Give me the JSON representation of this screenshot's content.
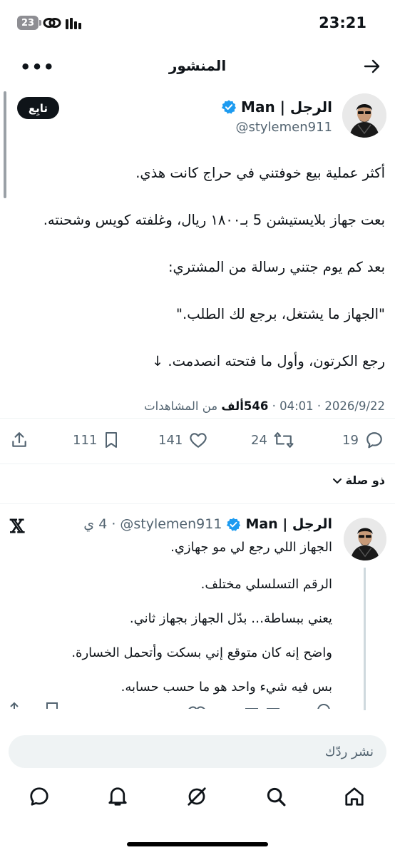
{
  "status_bar": {
    "time": "23:21",
    "battery": "23"
  },
  "header": {
    "title": "المنشور",
    "more": "•••"
  },
  "post": {
    "author_name": "الرجل | Man",
    "handle": "@stylemen911",
    "follow_label": "تابِع",
    "body": [
      "أكثر عملية بيع خوفتني في حراج كانت هذي.",
      "بعت جهاز بلايستيشن 5 بـ١٨٠٠ ريال، وغلفته كويس وشحنته.",
      "بعد كم يوم جتني رسالة من المشتري:",
      "\"الجهاز ما يشتغل، برجع لك الطلب.\"",
      "رجع الكرتون، وأول ما فتحته انصدمت. ↓"
    ],
    "date": "2026/9/22",
    "time": "04:01",
    "views_count": "546ألف",
    "views_label": "من المشاهدات",
    "separator": "·",
    "replies": "19",
    "reposts": "24",
    "likes": "141",
    "bookmarks": "111"
  },
  "related_label": "ذو صلة",
  "related_post": {
    "author_name": "الرجل | Man",
    "handle": "@stylemen911",
    "age": "4 ي",
    "separator": "·",
    "platform_logo": "𝕏",
    "body": [
      "الجهاز اللي رجع لي مو جهازي.",
      "الرقم التسلسلي مختلف.",
      "يعني ببساطة… بدّل الجهاز بجهاز ثاني.",
      "واضح إنه كان متوقع إني بسكت وأتحمل الخسارة.",
      "بس فيه شيء واحد هو ما حسب حسابه."
    ]
  },
  "reply": {
    "placeholder": "نشر ردّك"
  },
  "colors": {
    "verified": "#1d9bf0",
    "secondary_text": "#536471",
    "primary_text": "#0f1419"
  }
}
